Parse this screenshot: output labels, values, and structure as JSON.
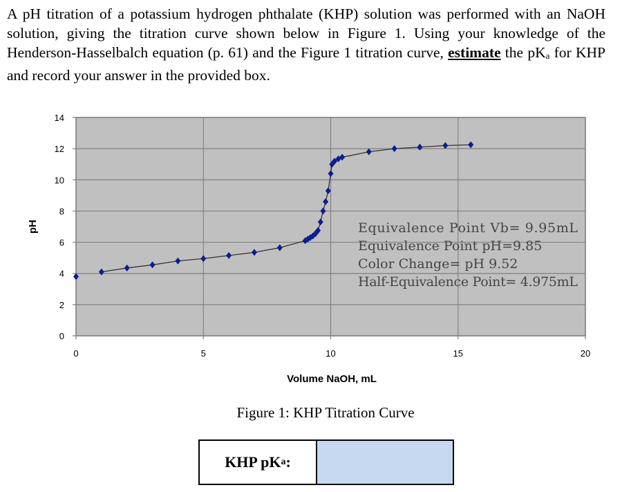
{
  "question": {
    "part1": "A pH titration of a potassium hydrogen phthalate (KHP) solution was performed with an NaOH solution, giving the titration curve shown below in Figure 1.  Using your knowledge of the Henderson-Hasselbalch equation (p. 61) and the Figure 1 titration curve, ",
    "emphasis": "estimate",
    "part2": " the pK",
    "subscript": "a",
    "part3": " for KHP and record your answer in the provided box."
  },
  "chart_data": {
    "type": "scatter",
    "xlabel": "Volume NaOH, mL",
    "ylabel": "pH",
    "xlim": [
      0,
      20
    ],
    "ylim": [
      0,
      14
    ],
    "xticks": [
      0,
      5,
      10,
      15,
      20
    ],
    "yticks": [
      0,
      2,
      4,
      6,
      8,
      10,
      12,
      14
    ],
    "grid": true,
    "marker_color": "#0a1f8f",
    "line_color": "#333333",
    "plot_background": "#c0c0c0",
    "x": [
      0,
      1,
      2,
      3,
      4,
      5,
      6,
      7,
      8,
      9,
      9.1,
      9.2,
      9.3,
      9.4,
      9.5,
      9.6,
      9.7,
      9.8,
      9.9,
      10,
      10.05,
      10.15,
      10.3,
      10.45,
      11.5,
      12.5,
      13.5,
      14.5,
      15.5
    ],
    "y": [
      3.8,
      4.1,
      4.35,
      4.55,
      4.8,
      4.95,
      5.15,
      5.35,
      5.65,
      6.1,
      6.2,
      6.3,
      6.4,
      6.55,
      6.75,
      7.3,
      8.0,
      8.6,
      9.3,
      10.4,
      11.0,
      11.2,
      11.35,
      11.45,
      11.8,
      12.0,
      12.1,
      12.2,
      12.25
    ],
    "annotations": [
      "Equivalence Point Vb= 9.95mL",
      "Equivalence Point pH=9.85",
      "Color Change= pH 9.52",
      "Half-Equivalence Point= 4.975mL"
    ]
  },
  "caption": "Figure 1: KHP Titration Curve",
  "answer": {
    "label": "KHP pK",
    "label_sub": "a",
    "label_suffix": ":",
    "value": ""
  }
}
